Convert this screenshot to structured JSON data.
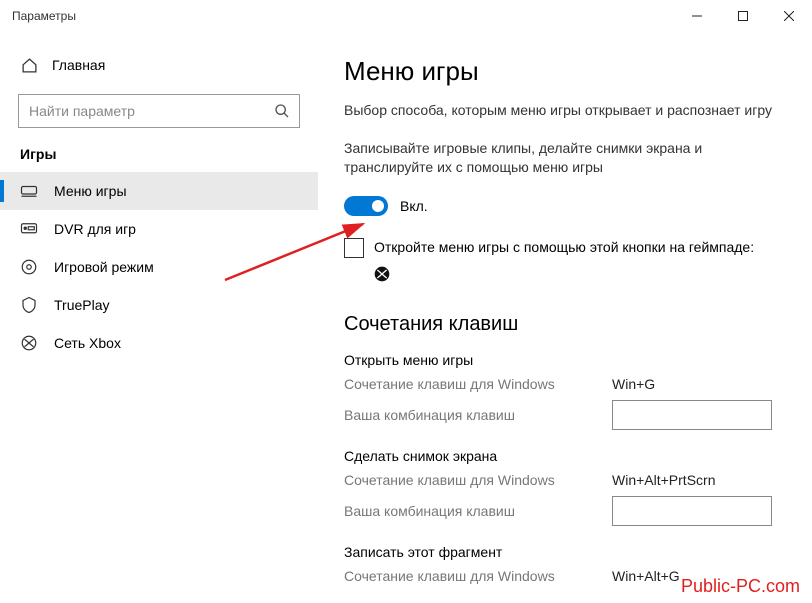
{
  "window": {
    "title": "Параметры"
  },
  "sidebar": {
    "home": "Главная",
    "search_placeholder": "Найти параметр",
    "category": "Игры",
    "items": [
      {
        "label": "Меню игры"
      },
      {
        "label": "DVR для игр"
      },
      {
        "label": "Игровой режим"
      },
      {
        "label": "TruePlay"
      },
      {
        "label": "Сеть Xbox"
      }
    ]
  },
  "main": {
    "title": "Меню игры",
    "subtitle": "Выбор способа, которым меню игры открывает и распознает игру",
    "toggle_desc": "Записывайте игровые клипы, делайте снимки экрана и транслируйте их с помощью меню игры",
    "toggle_state": "Вкл.",
    "checkbox_label": "Откройте меню игры с помощью этой кнопки на геймпаде:",
    "shortcuts_heading": "Сочетания клавиш",
    "shortcut_row_labels": {
      "win": "Сочетание клавиш для Windows",
      "custom": "Ваша комбинация клавиш"
    },
    "shortcuts": [
      {
        "title": "Открыть меню игры",
        "win_combo": "Win+G"
      },
      {
        "title": "Сделать снимок экрана",
        "win_combo": "Win+Alt+PrtScrn"
      },
      {
        "title": "Записать этот фрагмент",
        "win_combo": "Win+Alt+G"
      }
    ]
  },
  "watermark": "Public-PC.com"
}
